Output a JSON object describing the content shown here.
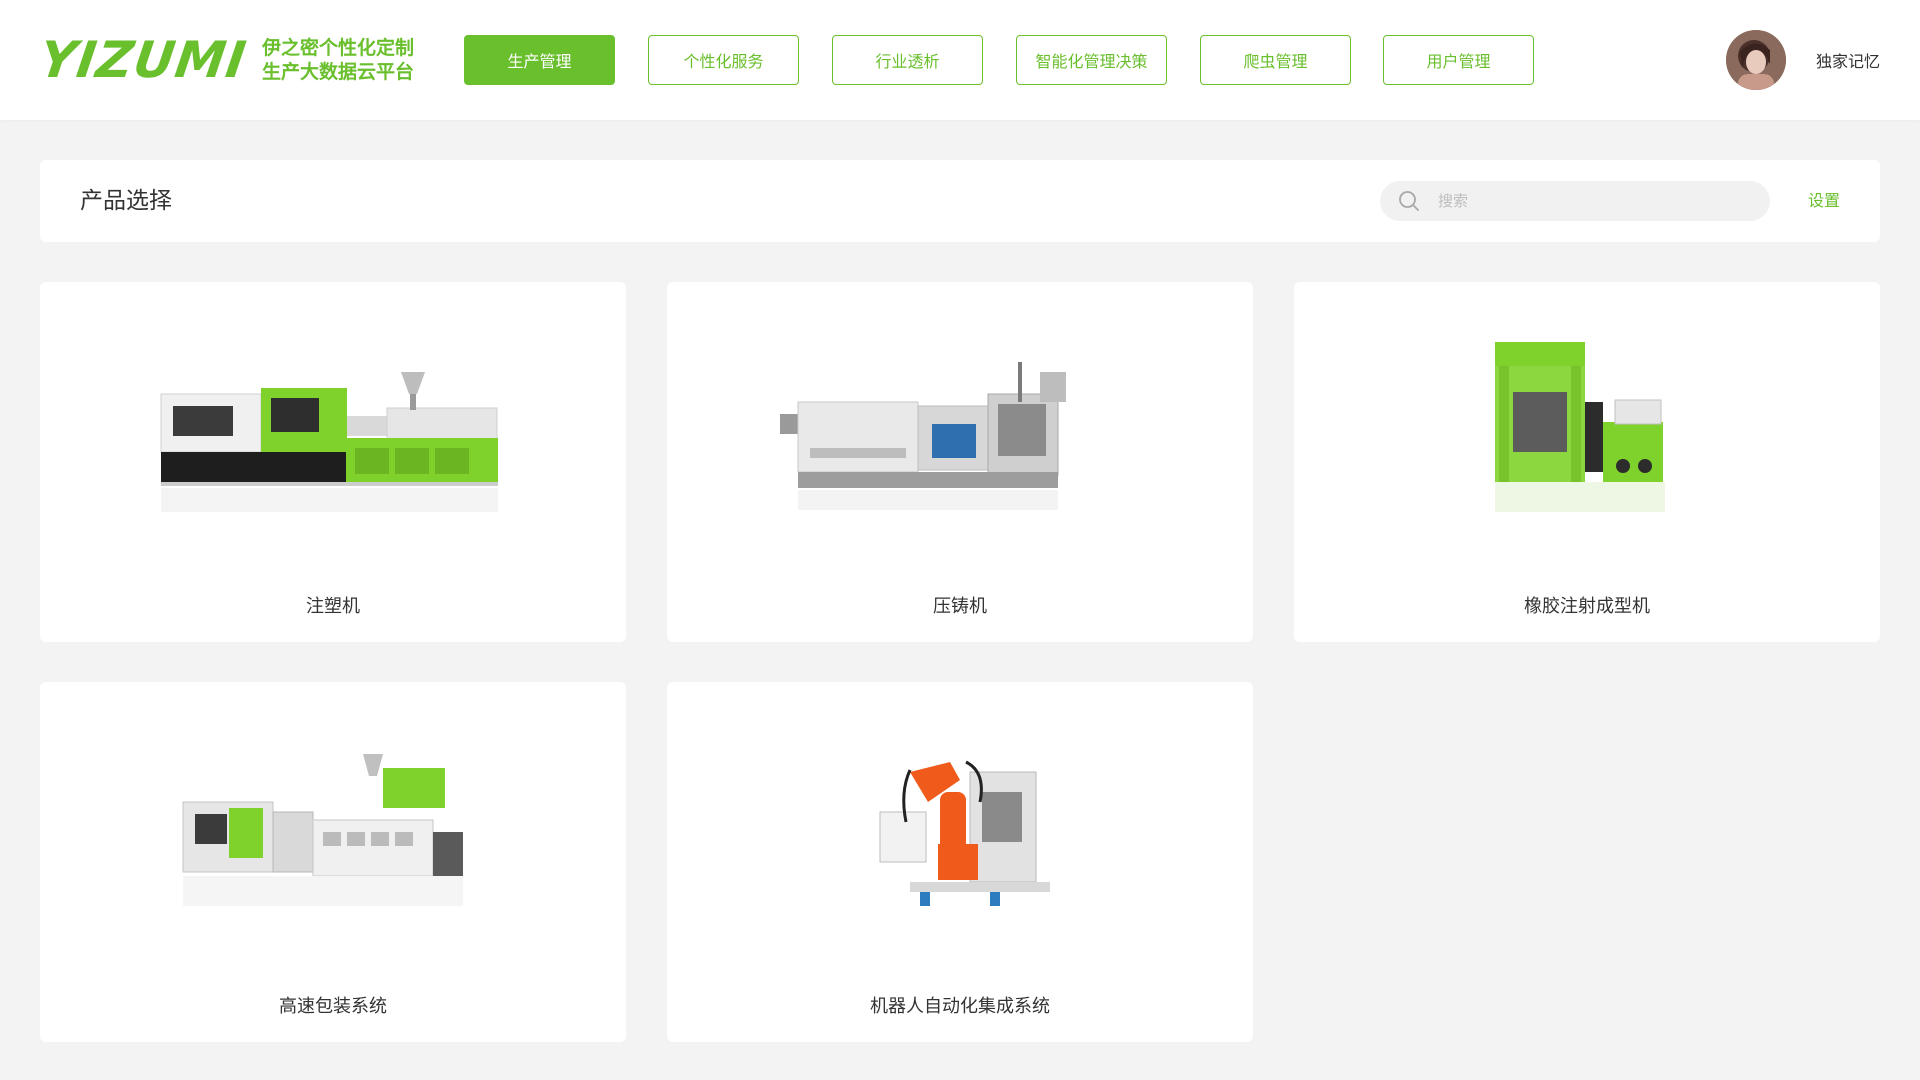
{
  "brand": {
    "logo": "YIZUMI",
    "tagline_line1": "伊之密个性化定制",
    "tagline_line2": "生产大数据云平台",
    "accent_color": "#6abf2d"
  },
  "nav": {
    "items": [
      {
        "label": "生产管理",
        "active": true
      },
      {
        "label": "个性化服务",
        "active": false
      },
      {
        "label": "行业透析",
        "active": false
      },
      {
        "label": "智能化管理决策",
        "active": false
      },
      {
        "label": "爬虫管理",
        "active": false
      },
      {
        "label": "用户管理",
        "active": false
      }
    ]
  },
  "user": {
    "name": "独家记忆",
    "avatar_icon": "avatar"
  },
  "filter": {
    "title": "产品选择",
    "search_placeholder": "搜索",
    "search_value": "",
    "search_icon": "search-icon",
    "settings_label": "设置"
  },
  "products": [
    {
      "label": "注塑机",
      "icon": "injection-molding-machine"
    },
    {
      "label": "压铸机",
      "icon": "die-casting-machine"
    },
    {
      "label": "橡胶注射成型机",
      "icon": "rubber-injection-molding-machine"
    },
    {
      "label": "高速包装系统",
      "icon": "high-speed-packaging-system"
    },
    {
      "label": "机器人自动化集成系统",
      "icon": "robot-automation-system"
    }
  ]
}
